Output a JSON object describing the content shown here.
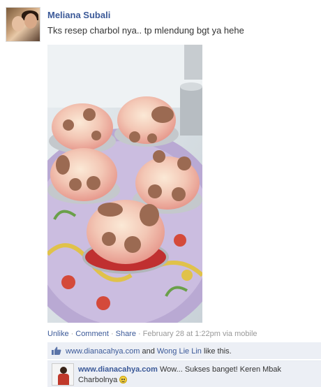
{
  "post": {
    "author": "Meliana Subali",
    "text": "Tks resep charbol nya.. tp mlendung bgt ya hehe"
  },
  "actions": {
    "unlike": "Unlike",
    "comment": "Comment",
    "share": "Share",
    "timestamp": "February 28 at 1:22pm via mobile",
    "separator": "·"
  },
  "likes": {
    "user1": "www.dianacahya.com",
    "and": "and",
    "user2": "Wong Lie Lin",
    "suffix": "like this."
  },
  "comment": {
    "author": "www.dianacahya.com",
    "text": "Wow... Sukses banget! Keren Mbak Charbolnya"
  },
  "icons": {
    "like": "thumbs-up-icon",
    "emoticon": "smiley-icon"
  },
  "colors": {
    "link": "#3b5998",
    "meta": "#999999",
    "ufi_background": "#eceff5"
  }
}
